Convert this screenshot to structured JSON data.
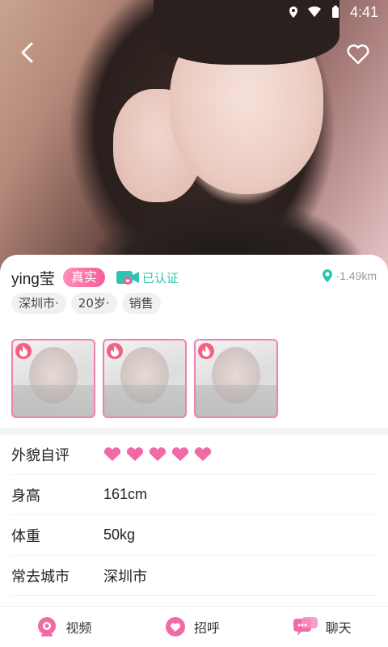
{
  "status_bar": {
    "time": "4:41"
  },
  "profile": {
    "name": "ying莹",
    "real_badge": "真实",
    "verified_label": "已认证",
    "distance": "·1.49km",
    "tags": [
      "深圳市·",
      "20岁·",
      "销售"
    ],
    "photos_count": 3
  },
  "details": [
    {
      "label": "外貌自评",
      "hearts": 5
    },
    {
      "label": "身高",
      "value": "161cm"
    },
    {
      "label": "体重",
      "value": "50kg"
    },
    {
      "label": "常去城市",
      "value": "深圳市"
    }
  ],
  "bottom_bar": {
    "video": "视频",
    "greet": "招呼",
    "chat": "聊天"
  },
  "colors": {
    "accent_pink": "#f35f98",
    "verified_teal": "#2cc6b0",
    "heart_pink": "#f06aa6"
  },
  "icons": [
    "back-arrow-icon",
    "heart-outline-icon",
    "video-camera-icon",
    "location-pin-icon",
    "flame-icon",
    "chat-bubble-icon"
  ]
}
